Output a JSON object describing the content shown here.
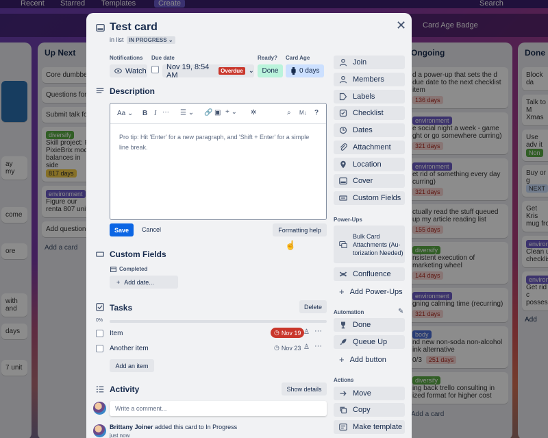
{
  "topnav": {
    "recent": "Recent",
    "starred": "Starred",
    "templates": "Templates",
    "create": "Create",
    "search": "Search"
  },
  "board": {
    "powerup_label": "Card Age Badge",
    "lists": {
      "up_next": {
        "title": "Up Next",
        "cards": [
          "Core dumbbell",
          "Questions for c",
          "Submit talk for",
          "Skill project: Pu PixieBrix mod t balances in side",
          "Figure our renta 807 unit",
          "Add questions t"
        ],
        "label_diversify": "diversify",
        "label_environment": "environment",
        "days_817": "817 days",
        "add_card": "Add a card"
      },
      "ongoing": {
        "title": "Ongoing",
        "cards": [
          {
            "text": "d a power-up that sets the d due date to the next checklist item",
            "badge": "136 days"
          },
          {
            "text": "e social night a week - game ght or go somewhere curring)",
            "label": "environment",
            "badge": "321 days"
          },
          {
            "text": "et rid of something every day curring)",
            "label": "environment",
            "badge": "321 days"
          },
          {
            "text": "ctually read the stuff queued up my article reading list",
            "badge": "155 days"
          },
          {
            "text": "nsistent execution of marketing wheel",
            "label": "diversify",
            "badge": "144 days"
          },
          {
            "text": "gning calming time (recurring)",
            "label": "environment",
            "badge": "321 days"
          },
          {
            "text": "nd new non-soda non-alcohol ink alternative",
            "label": "body",
            "check": "0/3",
            "badge": "251 days"
          },
          {
            "text": "ing back trello consulting in ized format for higher cost",
            "label": "diversify"
          }
        ],
        "add_card": "Add a card"
      },
      "done": {
        "title": "Done",
        "cards": [
          "Block da",
          "Talk to M Xmas",
          "Use adv it",
          "Buy or g",
          "Get Kris mug fro",
          "Clean u checklis",
          "Get rid c possess"
        ],
        "label_environment": "environment",
        "label_environ": "environ",
        "label_non": "Non",
        "label_next": "NEXT",
        "add_card": "Add"
      },
      "left_partial": [
        "ay my",
        "come",
        "ore",
        "with and",
        "days",
        "7 unit"
      ]
    }
  },
  "card": {
    "title": "Test card",
    "in_list_prefix": "in list",
    "list_name": "IN PROGRESS",
    "notifications_label": "Notifications",
    "watch_label": "Watch",
    "due_date_label": "Due date",
    "due_date_value": "Nov 19, 8:54 AM",
    "overdue_badge": "Overdue",
    "ready_label": "Ready?",
    "ready_value": "Done",
    "card_age_label": "Card Age",
    "card_age_value": "0 days",
    "description_title": "Description",
    "editor": {
      "text_style": "Aa",
      "bold": "B",
      "italic": "I",
      "more": "···",
      "help": "?",
      "placeholder": "Pro tip: Hit 'Enter' for a new paragraph, and 'Shift + Enter' for a simple line break."
    },
    "save_button": "Save",
    "cancel_button": "Cancel",
    "formatting_help_button": "Formatting help",
    "custom_fields_title": "Custom Fields",
    "completed_label": "Completed",
    "add_date_button": "Add date...",
    "tasks_title": "Tasks",
    "delete_button": "Delete",
    "progress_percent": "0%",
    "progress_fraction": 0,
    "tasks": [
      {
        "name": "Item",
        "due": "Nov 19",
        "overdue": true
      },
      {
        "name": "Another item",
        "due": "Nov 23",
        "overdue": false
      }
    ],
    "add_item_button": "Add an item",
    "activity_title": "Activity",
    "show_details_button": "Show details",
    "comment_placeholder": "Write a comment...",
    "activity_entry": {
      "user": "Brittany Joiner",
      "action": "added this card to In Progress",
      "time": "just now"
    }
  },
  "sidebar": {
    "add_to_card": [
      {
        "label": "Join",
        "icon": "user-icon"
      },
      {
        "label": "Members",
        "icon": "user-icon"
      },
      {
        "label": "Labels",
        "icon": "tag-icon"
      },
      {
        "label": "Checklist",
        "icon": "checkbox-icon"
      },
      {
        "label": "Dates",
        "icon": "clock-icon"
      },
      {
        "label": "Attachment",
        "icon": "paperclip-icon"
      },
      {
        "label": "Location",
        "icon": "pin-icon"
      },
      {
        "label": "Cover",
        "icon": "card-icon"
      },
      {
        "label": "Custom Fields",
        "icon": "fields-icon"
      }
    ],
    "power_ups_heading": "Power-Ups",
    "power_ups": [
      {
        "label": "Bulk Card Attachments (Au-torization Needed)",
        "icon": "chat-icon"
      },
      {
        "label": "Confluence",
        "icon": "confluence-icon"
      }
    ],
    "add_power_ups": "Add Power-Ups",
    "automation_heading": "Automation",
    "automation": [
      {
        "label": "Done",
        "icon": "trophy-icon"
      },
      {
        "label": "Queue Up",
        "icon": "rocket-icon"
      }
    ],
    "add_button": "Add button",
    "actions_heading": "Actions",
    "actions": [
      {
        "label": "Move",
        "icon": "arrow-icon"
      },
      {
        "label": "Copy",
        "icon": "copy-icon"
      },
      {
        "label": "Make template",
        "icon": "template-icon"
      }
    ]
  },
  "colors": {
    "overdue": "#c9372c",
    "ready_green": "#baf3db",
    "card_age_blue": "#cce0ff",
    "save_blue": "#0c66e4"
  }
}
